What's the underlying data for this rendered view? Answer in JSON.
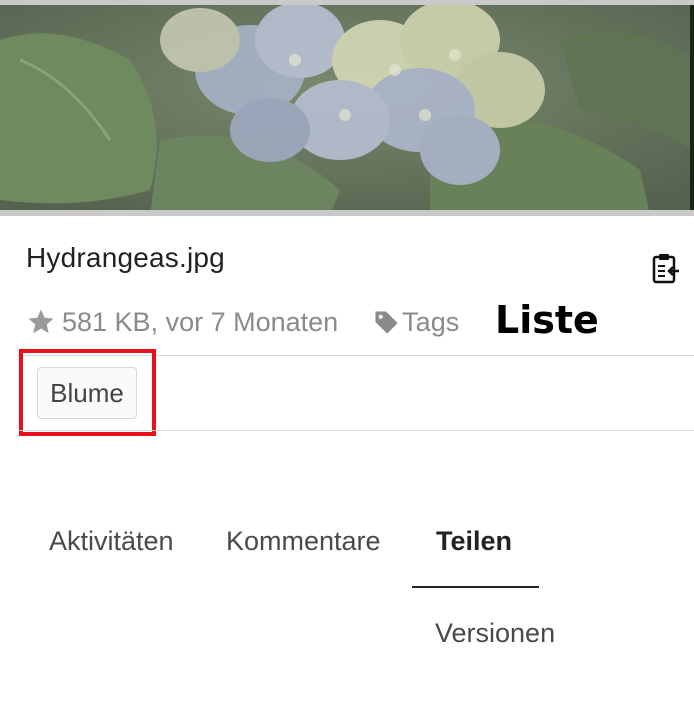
{
  "preview": {
    "alt": "Hydrangeas"
  },
  "file": {
    "name": "Hydrangeas.jpg",
    "size_and_date": "581 KB, vor 7 Monaten",
    "tags_label": "Tags"
  },
  "annotation": {
    "label": "Liste",
    "highlight_color": "#e8111b"
  },
  "tags": [
    "Blume"
  ],
  "tabs": [
    {
      "label": "Aktivitäten",
      "active": false
    },
    {
      "label": "Kommentare",
      "active": false
    },
    {
      "label": "Teilen",
      "active": true
    },
    {
      "label": "Versionen",
      "active": false
    }
  ],
  "colors": {
    "meta_gray": "#8a8a8a",
    "divider": "#dadada"
  },
  "icons": {
    "favorite": "star-icon",
    "tags": "tag-icon",
    "clipboard": "clipboard-icon"
  }
}
